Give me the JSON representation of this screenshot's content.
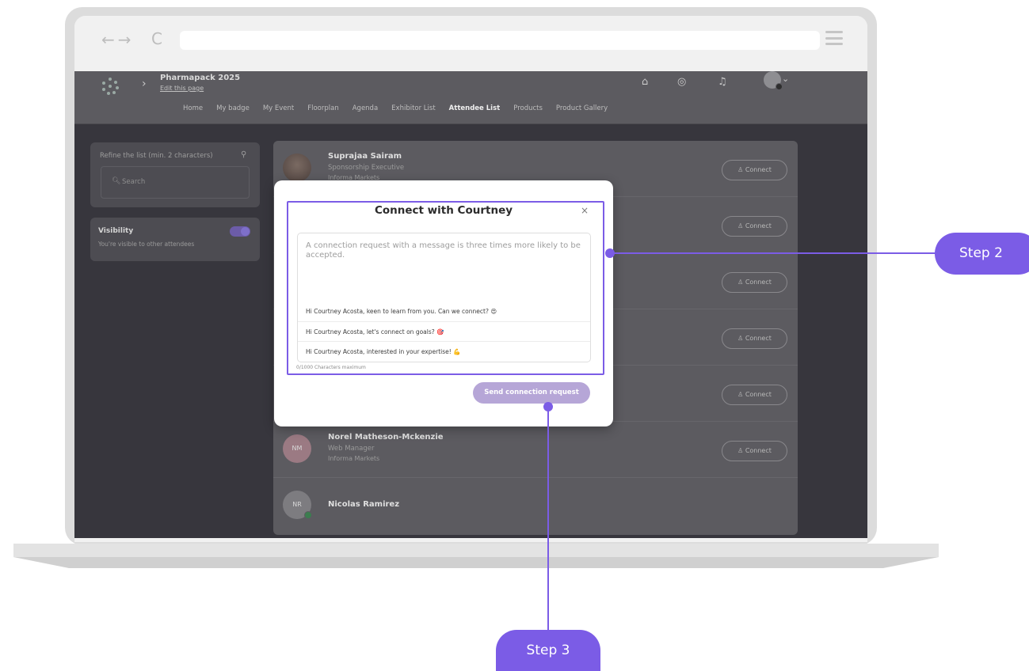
{
  "browser": {
    "back_icon": "arrow-left-icon",
    "forward_icon": "arrow-right-icon",
    "reload_icon": "reload-icon",
    "menu_icon": "hamburger-icon",
    "url": ""
  },
  "header": {
    "event_name": "Pharmapack 2025",
    "edit_link": "Edit this page",
    "nav": [
      "Home",
      "My badge",
      "My Event",
      "Floorplan",
      "Agenda",
      "Exhibitor List",
      "Attendee List",
      "Products",
      "Product Gallery"
    ],
    "active_nav": "Attendee List"
  },
  "sidebar": {
    "filter_label": "Refine the list (min. 2 characters)",
    "search_placeholder": "Search",
    "visibility_title": "Visibility",
    "visibility_sub": "You're visible to other attendees",
    "visibility_on": true
  },
  "attendees": [
    {
      "name": "Suprajaa Sairam",
      "title": "Sponsorship Executive",
      "company": "Informa Markets",
      "initials": "",
      "connect": "Connect"
    },
    {
      "name": "",
      "title": "",
      "company": "",
      "initials": "",
      "connect": "Connect"
    },
    {
      "name": "",
      "title": "",
      "company": "",
      "initials": "",
      "connect": "Connect"
    },
    {
      "name": "",
      "title": "",
      "company": "",
      "initials": "",
      "connect": "Connect"
    },
    {
      "name": "",
      "title": "",
      "company": "",
      "initials": "",
      "connect": "Connect"
    },
    {
      "name": "Norel Matheson-Mckenzie",
      "title": "Web Manager",
      "company": "Informa Markets",
      "initials": "NM",
      "connect": "Connect"
    },
    {
      "name": "Nicolas Ramirez",
      "title": "",
      "company": "",
      "initials": "NR",
      "connect": ""
    }
  ],
  "modal": {
    "title": "Connect with Courtney",
    "close": "×",
    "placeholder": "A connection request with a message is three times more likely to be accepted.",
    "suggestions": [
      "Hi Courtney Acosta, keen to learn from you. Can we connect? 😍",
      "Hi Courtney Acosta, let's connect on goals? 🎯",
      "Hi Courtney Acosta, interested in your expertise! 💪"
    ],
    "char_count": "0/1000 Characters maximum",
    "send_button": "Send connection request"
  },
  "annotations": {
    "step2": "Step 2",
    "step3": "Step 3",
    "accent": "#7b5ce6"
  }
}
